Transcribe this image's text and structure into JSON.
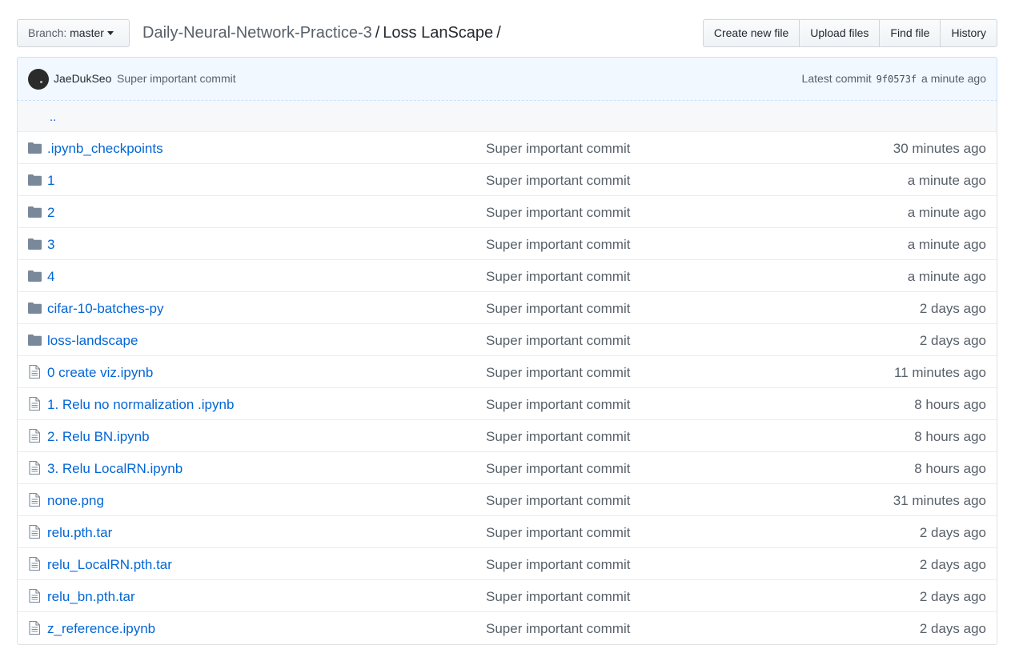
{
  "branch": {
    "label": "Branch:",
    "value": "master"
  },
  "breadcrumb": {
    "repo": "Daily-Neural-Network-Practice-3",
    "separator": "/",
    "current": "Loss LanScape",
    "trailing": "/"
  },
  "actions": [
    "Create new file",
    "Upload files",
    "Find file",
    "History"
  ],
  "commit": {
    "author": "JaeDukSeo",
    "message": "Super important commit",
    "latest_label": "Latest commit",
    "sha": "9f0573f",
    "time": "a minute ago"
  },
  "up_link": "..",
  "files": [
    {
      "type": "dir",
      "icon": "folder-icon",
      "name": ".ipynb_checkpoints",
      "message": "Super important commit",
      "age": "30 minutes ago"
    },
    {
      "type": "dir",
      "icon": "folder-icon",
      "name": "1",
      "message": "Super important commit",
      "age": "a minute ago"
    },
    {
      "type": "dir",
      "icon": "folder-icon",
      "name": "2",
      "message": "Super important commit",
      "age": "a minute ago"
    },
    {
      "type": "dir",
      "icon": "folder-icon",
      "name": "3",
      "message": "Super important commit",
      "age": "a minute ago"
    },
    {
      "type": "dir",
      "icon": "folder-icon",
      "name": "4",
      "message": "Super important commit",
      "age": "a minute ago"
    },
    {
      "type": "dir",
      "icon": "folder-icon",
      "name": "cifar-10-batches-py",
      "message": "Super important commit",
      "age": "2 days ago"
    },
    {
      "type": "dir",
      "icon": "folder-icon",
      "name": "loss-landscape",
      "message": "Super important commit",
      "age": "2 days ago"
    },
    {
      "type": "file",
      "icon": "file-icon",
      "name": "0 create viz.ipynb",
      "message": "Super important commit",
      "age": "11 minutes ago"
    },
    {
      "type": "file",
      "icon": "file-icon",
      "name": "1. Relu no normalization .ipynb",
      "message": "Super important commit",
      "age": "8 hours ago"
    },
    {
      "type": "file",
      "icon": "file-icon",
      "name": "2. Relu BN.ipynb",
      "message": "Super important commit",
      "age": "8 hours ago"
    },
    {
      "type": "file",
      "icon": "file-icon",
      "name": "3. Relu LocalRN.ipynb",
      "message": "Super important commit",
      "age": "8 hours ago"
    },
    {
      "type": "file",
      "icon": "file-icon",
      "name": "none.png",
      "message": "Super important commit",
      "age": "31 minutes ago"
    },
    {
      "type": "file",
      "icon": "file-icon",
      "name": "relu.pth.tar",
      "message": "Super important commit",
      "age": "2 days ago"
    },
    {
      "type": "file",
      "icon": "file-icon",
      "name": "relu_LocalRN.pth.tar",
      "message": "Super important commit",
      "age": "2 days ago"
    },
    {
      "type": "file",
      "icon": "file-icon",
      "name": "relu_bn.pth.tar",
      "message": "Super important commit",
      "age": "2 days ago"
    },
    {
      "type": "file",
      "icon": "file-icon",
      "name": "z_reference.ipynb",
      "message": "Super important commit",
      "age": "2 days ago"
    }
  ],
  "colors": {
    "link": "#0366d6",
    "muted": "#586069",
    "icon": "#79889a",
    "commit_bg": "#f1f8ff"
  }
}
